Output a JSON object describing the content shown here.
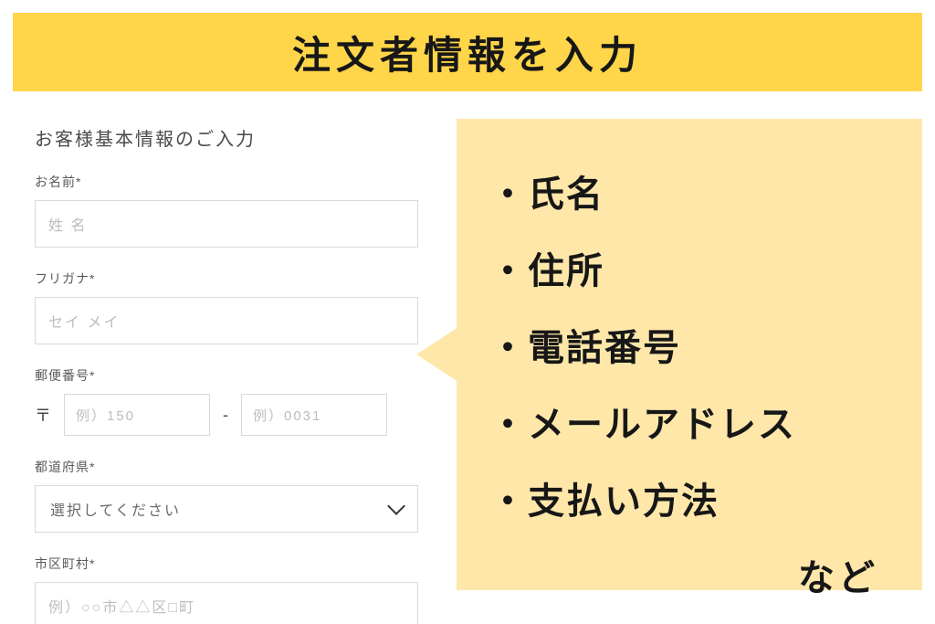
{
  "banner": {
    "title": "注文者情報を入力"
  },
  "form": {
    "heading": "お客様基本情報のご入力",
    "name": {
      "label": "お名前*",
      "placeholder": "姓 名"
    },
    "furigana": {
      "label": "フリガナ*",
      "placeholder": "セイ メイ"
    },
    "postal": {
      "label": "郵便番号*",
      "prefix": "〒",
      "ph1": "例）150",
      "sep": "-",
      "ph2": "例）0031"
    },
    "prefecture": {
      "label": "都道府県*",
      "placeholder": "選択してください"
    },
    "city": {
      "label": "市区町村*",
      "placeholder": "例）○○市△△区□町"
    }
  },
  "callout": {
    "items": [
      "・氏名",
      "・住所",
      "・電話番号",
      "・メールアドレス",
      "・支払い方法"
    ],
    "etc": "など"
  }
}
